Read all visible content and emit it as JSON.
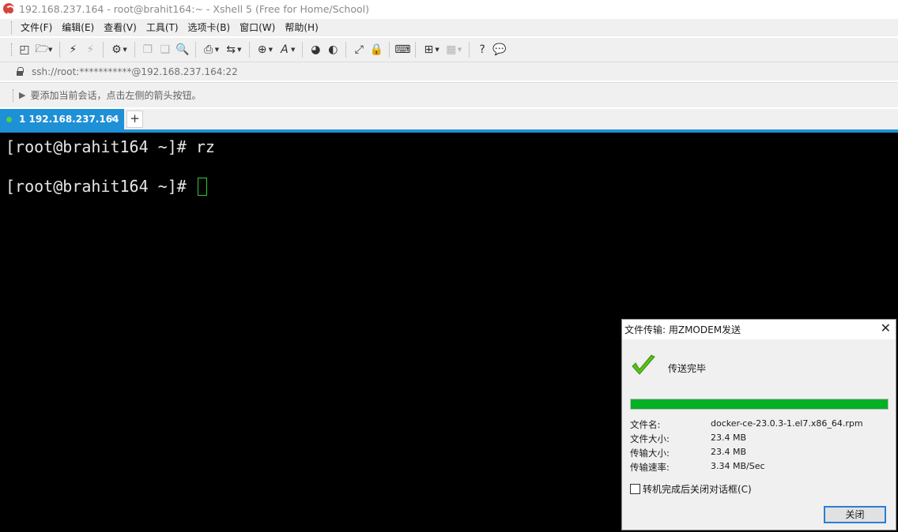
{
  "window": {
    "title": "192.168.237.164 - root@brahit164:~ - Xshell 5 (Free for Home/School)"
  },
  "menu": [
    {
      "label": "文件(F)"
    },
    {
      "label": "编辑(E)"
    },
    {
      "label": "查看(V)"
    },
    {
      "label": "工具(T)"
    },
    {
      "label": "选项卡(B)"
    },
    {
      "label": "窗口(W)"
    },
    {
      "label": "帮助(H)"
    }
  ],
  "address": {
    "text": "ssh://root:***********@192.168.237.164:22"
  },
  "hint": {
    "text": "要添加当前会话，点击左侧的箭头按钮。"
  },
  "tabs": [
    {
      "label": "1 192.168.237.164",
      "close": "×"
    }
  ],
  "tab_add": "+",
  "terminal": {
    "lines": [
      "[root@brahit164 ~]# rz",
      "[root@brahit164 ~]# "
    ]
  },
  "dialog": {
    "title": "文件传输: 用ZMODEM发送",
    "close": "✕",
    "status": "传送完毕",
    "progress": 1.0,
    "labels": {
      "filename": "文件名:",
      "filesize": "文件大小:",
      "transferred": "传输大小:",
      "rate": "传输速率:"
    },
    "values": {
      "filename": "docker-ce-23.0.3-1.el7.x86_64.rpm",
      "filesize": "23.4 MB",
      "transferred": "23.4 MB",
      "rate": "3.34 MB/Sec"
    },
    "checkbox_label": "转机完成后关闭对话框(C)",
    "checkbox_checked": false,
    "close_button": "关闭"
  },
  "colors": {
    "accent": "#1e90d6",
    "progress": "#06b025",
    "terminal_bg": "#000000",
    "cursor": "#2ecc40"
  }
}
